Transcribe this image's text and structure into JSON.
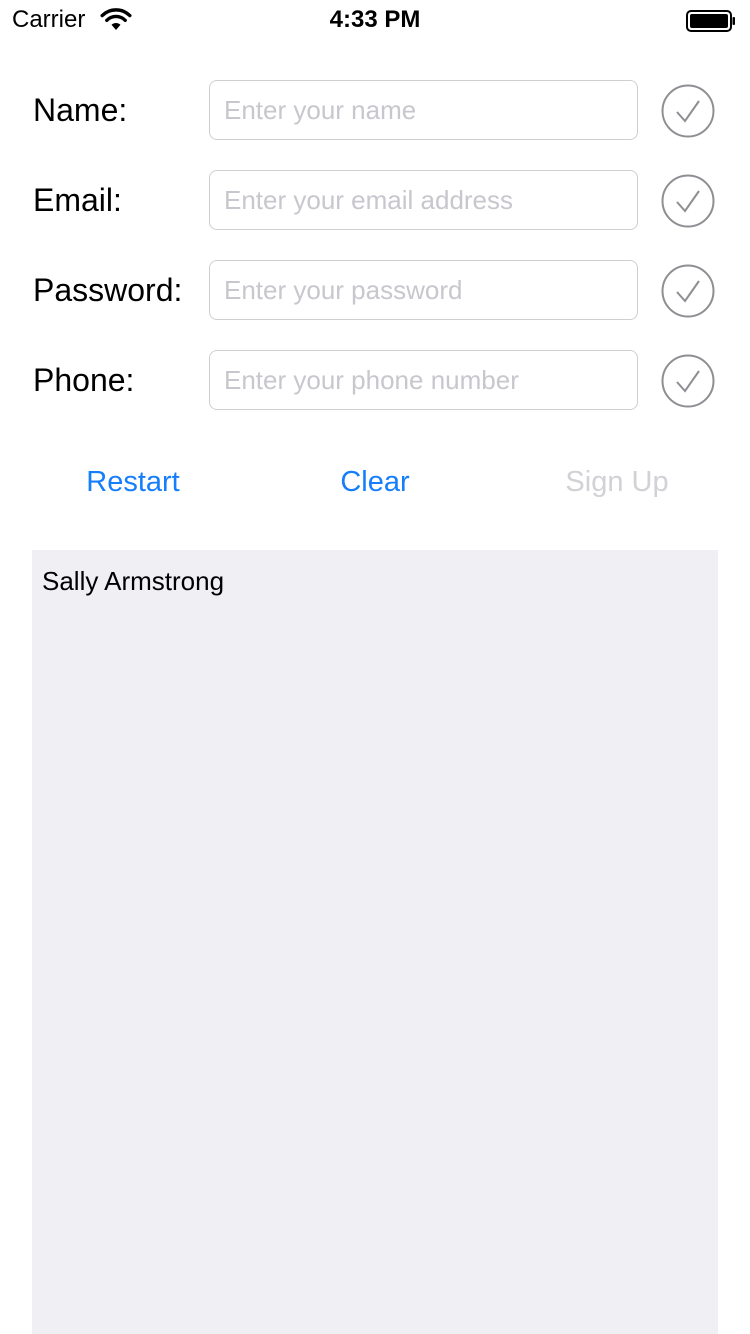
{
  "status_bar": {
    "carrier": "Carrier",
    "time": "4:33 PM",
    "wifi_icon": "wifi-icon",
    "battery_icon": "battery-icon"
  },
  "form": {
    "fields": [
      {
        "label": "Name:",
        "placeholder": "Enter your name",
        "value": "",
        "status_icon": "checkmark-circle-icon"
      },
      {
        "label": "Email:",
        "placeholder": "Enter your email address",
        "value": "",
        "status_icon": "checkmark-circle-icon"
      },
      {
        "label": "Password:",
        "placeholder": "Enter your password",
        "value": "",
        "status_icon": "checkmark-circle-icon"
      },
      {
        "label": "Phone:",
        "placeholder": "Enter your phone number",
        "value": "",
        "status_icon": "checkmark-circle-icon"
      }
    ]
  },
  "actions": {
    "restart_label": "Restart",
    "clear_label": "Clear",
    "signup_label": "Sign Up"
  },
  "output": {
    "text": "Sally Armstrong"
  },
  "colors": {
    "accent": "#157efb",
    "disabled": "#d1d1d6",
    "output_background": "#efeff4",
    "placeholder": "#c7c7cd"
  }
}
